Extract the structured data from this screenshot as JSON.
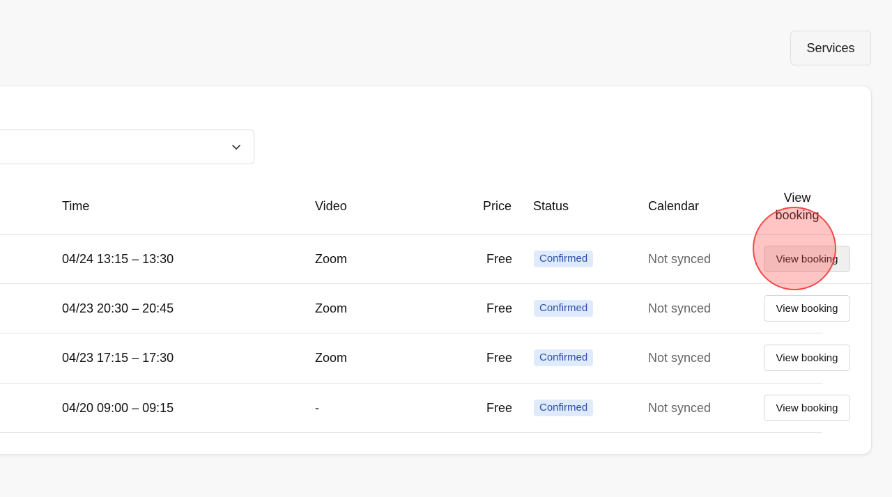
{
  "header": {
    "services_label": "Services"
  },
  "filter": {
    "value": "",
    "icon": "chevron-down-icon"
  },
  "table": {
    "columns": {
      "time": "Time",
      "video": "Video",
      "price": "Price",
      "status": "Status",
      "calendar": "Calendar",
      "view_line1": "View",
      "view_line2": "booking"
    },
    "rows": [
      {
        "time": "04/24 13:15 – 13:30",
        "video": "Zoom",
        "price": "Free",
        "status": "Confirmed",
        "calendar": "Not synced",
        "action": "View booking"
      },
      {
        "time": "04/23 20:30 – 20:45",
        "video": "Zoom",
        "price": "Free",
        "status": "Confirmed",
        "calendar": "Not synced",
        "action": "View booking"
      },
      {
        "time": "04/23 17:15 – 17:30",
        "video": "Zoom",
        "price": "Free",
        "status": "Confirmed",
        "calendar": "Not synced",
        "action": "View booking"
      },
      {
        "time": "04/20 09:00 – 09:15",
        "video": "-",
        "price": "Free",
        "status": "Confirmed",
        "calendar": "Not synced",
        "action": "View booking"
      }
    ]
  },
  "colors": {
    "badge_bg": "#dfeafc",
    "badge_text": "#2b4fa8",
    "click_indicator": "#f03c3c"
  }
}
